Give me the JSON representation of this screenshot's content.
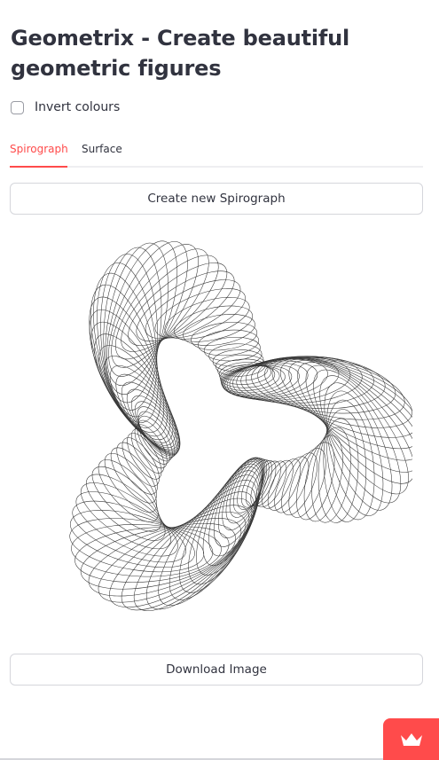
{
  "page": {
    "title": "Geometrix - Create beautiful geometric figures"
  },
  "controls": {
    "invert_label": "Invert colours",
    "invert_checked": false
  },
  "tabs": [
    {
      "label": "Spirograph",
      "active": true
    },
    {
      "label": "Surface",
      "active": false
    }
  ],
  "buttons": {
    "create_label": "Create new Spirograph",
    "download_label": "Download Image"
  },
  "figure": {
    "stroke_color": "#333333",
    "background_color": "#ffffff"
  },
  "badge": {
    "icon": "crown-icon",
    "color": "#ff4b4b"
  }
}
